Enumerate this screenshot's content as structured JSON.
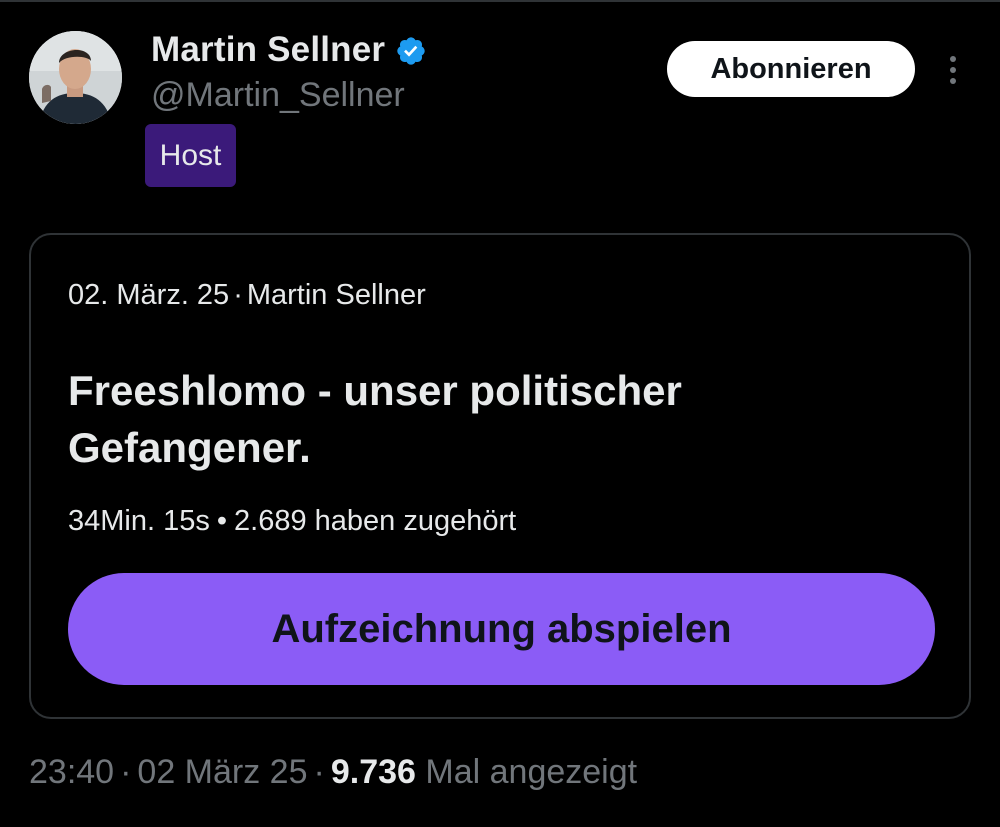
{
  "author": {
    "display_name": "Martin Sellner",
    "handle": "@Martin_Sellner",
    "role_badge": "Host",
    "verified_icon": "verified-badge-icon",
    "verified_color": "#1d9bf0"
  },
  "actions": {
    "follow_label": "Abonnieren",
    "more_icon": "more-vertical-icon"
  },
  "space_card": {
    "date": "02. März. 25",
    "separator": "·",
    "host_name": "Martin Sellner",
    "title": "Freeshlomo - unser politischer Gefangener.",
    "duration": "34Min. 15s",
    "stats_separator": "•",
    "listeners": "2.689 haben zugehört",
    "play_label": "Aufzeichnung abspielen",
    "accent_color": "#8b5cf6"
  },
  "footer": {
    "time": "23:40",
    "separator": "·",
    "date": "02 März 25",
    "views_count": "9.736",
    "views_label": "Mal angezeigt"
  },
  "colors": {
    "background": "#000000",
    "text_primary": "#e7e9ea",
    "text_secondary": "#71767b",
    "border": "#2f3336",
    "host_badge": "#3b1a7a"
  }
}
